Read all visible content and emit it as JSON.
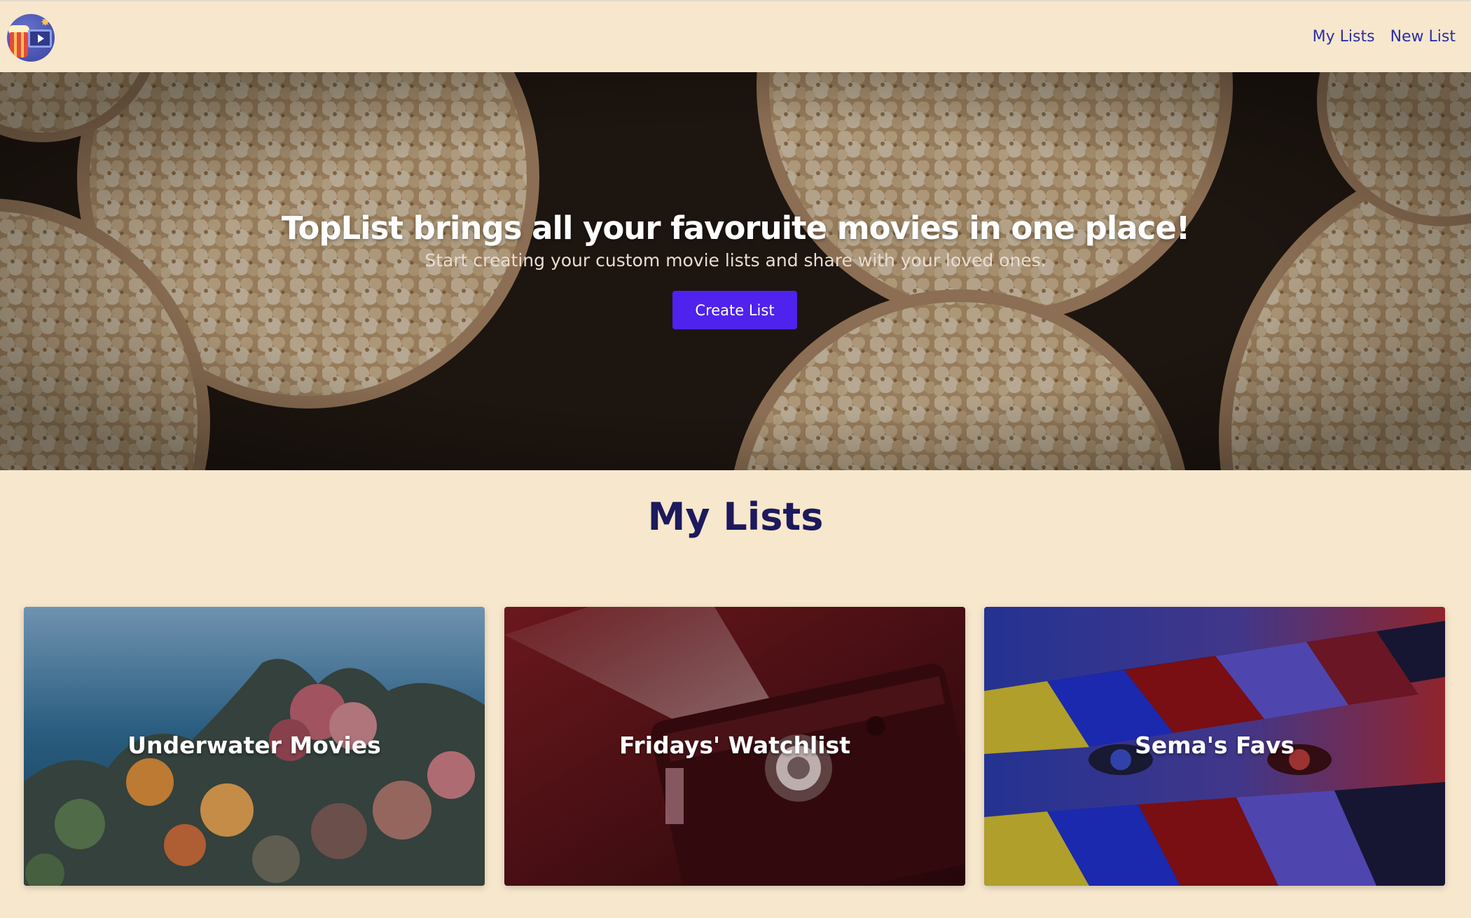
{
  "header": {
    "logo_icon": "popcorn-film-logo-icon",
    "nav": [
      {
        "label": "My Lists"
      },
      {
        "label": "New List"
      }
    ]
  },
  "hero": {
    "title": "TopList brings all your favoruite movies in one place!",
    "subtitle": "Start creating your custom movie lists and share with your loved ones.",
    "cta_label": "Create List"
  },
  "lists": {
    "title": "My Lists",
    "cards": [
      {
        "label": "Underwater Movies"
      },
      {
        "label": "Fridays' Watchlist"
      },
      {
        "label": "Sema's Favs"
      }
    ]
  },
  "colors": {
    "background": "#f7e7cd",
    "nav_link": "#2b2fa8",
    "cta": "#4f22ee",
    "section_title": "#1c1a5c"
  }
}
